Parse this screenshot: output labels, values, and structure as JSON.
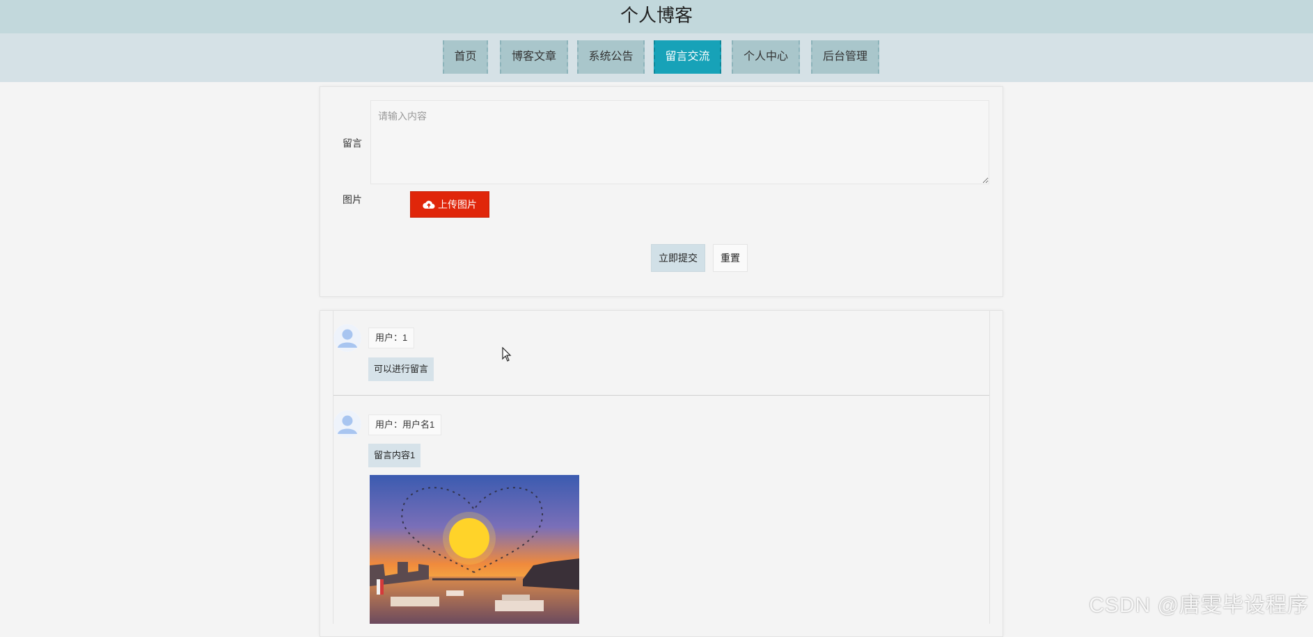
{
  "site": {
    "title": "个人博客"
  },
  "nav": {
    "items": [
      {
        "label": "首页"
      },
      {
        "label": "博客文章"
      },
      {
        "label": "系统公告"
      },
      {
        "label": "留言交流"
      },
      {
        "label": "个人中心"
      },
      {
        "label": "后台管理"
      }
    ],
    "active_index": 3
  },
  "form": {
    "message_label": "留言",
    "message_placeholder": "请输入内容",
    "message_value": "",
    "image_label": "图片",
    "upload_label": "上传图片",
    "submit_label": "立即提交",
    "reset_label": "重置"
  },
  "comments": [
    {
      "user": "用户：1",
      "content": "可以进行留言"
    },
    {
      "user": "用户：用户名1",
      "content": "留言内容1"
    }
  ],
  "watermark": "CSDN @唐雯毕设程序",
  "colors": {
    "topbar": "#c2d8dc",
    "navbar": "#d5e1e6",
    "nav_item": "#a9c6cb",
    "nav_active": "#17a2b8",
    "upload_button": "#e0260a",
    "submit_button": "#d1e0e7"
  }
}
